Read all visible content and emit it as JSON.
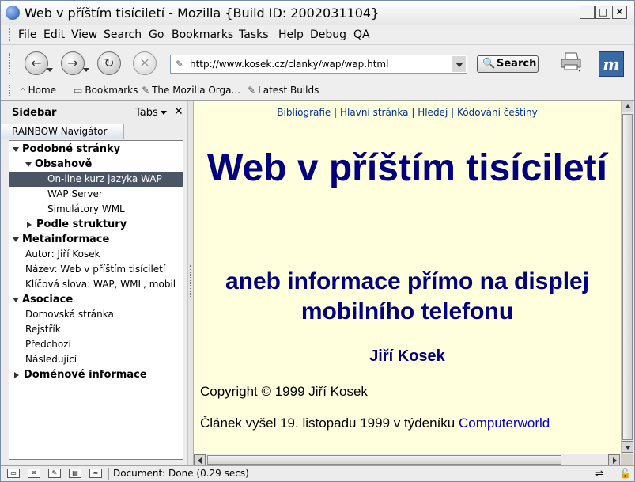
{
  "window": {
    "title": "Web v příštím tisíciletí - Mozilla {Build ID: 2002031104}",
    "minimize": "_",
    "maximize": "□",
    "close": "✕"
  },
  "menu": {
    "items": [
      "File",
      "Edit",
      "View",
      "Search",
      "Go",
      "Bookmarks",
      "Tasks",
      "Help",
      "Debug",
      "QA"
    ]
  },
  "nav": {
    "back_glyph": "←",
    "forward_glyph": "→",
    "reload_glyph": "↻",
    "stop_glyph": "✕",
    "url": "http://www.kosek.cz/clanky/wap/wap.html",
    "search_label": "Search",
    "logo_letter": "m"
  },
  "personal_toolbar": {
    "items": [
      {
        "icon": "⌂",
        "label": "Home"
      },
      {
        "icon": "▭",
        "label": "Bookmarks"
      },
      {
        "icon": "✎",
        "label": "The Mozilla Orga..."
      },
      {
        "icon": "✎",
        "label": "Latest Builds"
      }
    ]
  },
  "sidebar": {
    "title": "Sidebar",
    "tabs_label": "Tabs",
    "close": "✕",
    "panel_tab": "RAINBOW Navigátor",
    "tree": [
      {
        "label": "Podobné stránky",
        "level": 0,
        "twisty": "open",
        "bold": true
      },
      {
        "label": "Obsahově",
        "level": 1,
        "twisty": "open",
        "bold": true
      },
      {
        "label": "On-line kurz jazyka WAP",
        "level": 2,
        "twisty": "none",
        "bold": false,
        "selected": true
      },
      {
        "label": "WAP Server",
        "level": 2,
        "twisty": "none",
        "bold": false
      },
      {
        "label": "Simulátory WML",
        "level": 2,
        "twisty": "none",
        "bold": false
      },
      {
        "label": "Podle struktury",
        "level": 1,
        "twisty": "closed",
        "bold": true
      },
      {
        "label": "Metainformace",
        "level": 0,
        "twisty": "open",
        "bold": true
      },
      {
        "label": "Autor: Jiří Kosek",
        "level": 1,
        "twisty": "none",
        "bold": false
      },
      {
        "label": "Název: Web v příštím tisíciletí",
        "level": 1,
        "twisty": "none",
        "bold": false
      },
      {
        "label": "Klíčová slova: WAP, WML, mobil",
        "level": 1,
        "twisty": "none",
        "bold": false
      },
      {
        "label": "Asociace",
        "level": 0,
        "twisty": "open",
        "bold": true
      },
      {
        "label": "Domovská stránka",
        "level": 1,
        "twisty": "none",
        "bold": false
      },
      {
        "label": "Rejstřík",
        "level": 1,
        "twisty": "none",
        "bold": false
      },
      {
        "label": "Předchozí",
        "level": 1,
        "twisty": "none",
        "bold": false
      },
      {
        "label": "Následující",
        "level": 1,
        "twisty": "none",
        "bold": false
      },
      {
        "label": "Doménové informace",
        "level": 0,
        "twisty": "closed",
        "bold": true
      }
    ]
  },
  "page": {
    "topnav": [
      "Bibliografie",
      "Hlavní stránka",
      "Hledej",
      "Kódování češtiny"
    ],
    "heading": "Web v příštím tisíciletí",
    "subheading": "aneb informace přímo na displej mobilního telefonu",
    "author": "Jiří Kosek",
    "copyright": "Copyright © 1999 Jiří Kosek",
    "article_prefix": "Článek vyšel 19. listopadu 1999 v týdeníku ",
    "article_link": "Computerworld",
    "colors": {
      "background": "#ffffdd",
      "heading": "#000080",
      "link": "#0000cc"
    }
  },
  "statusbar": {
    "text": "Document: Done (0.29 secs)"
  }
}
